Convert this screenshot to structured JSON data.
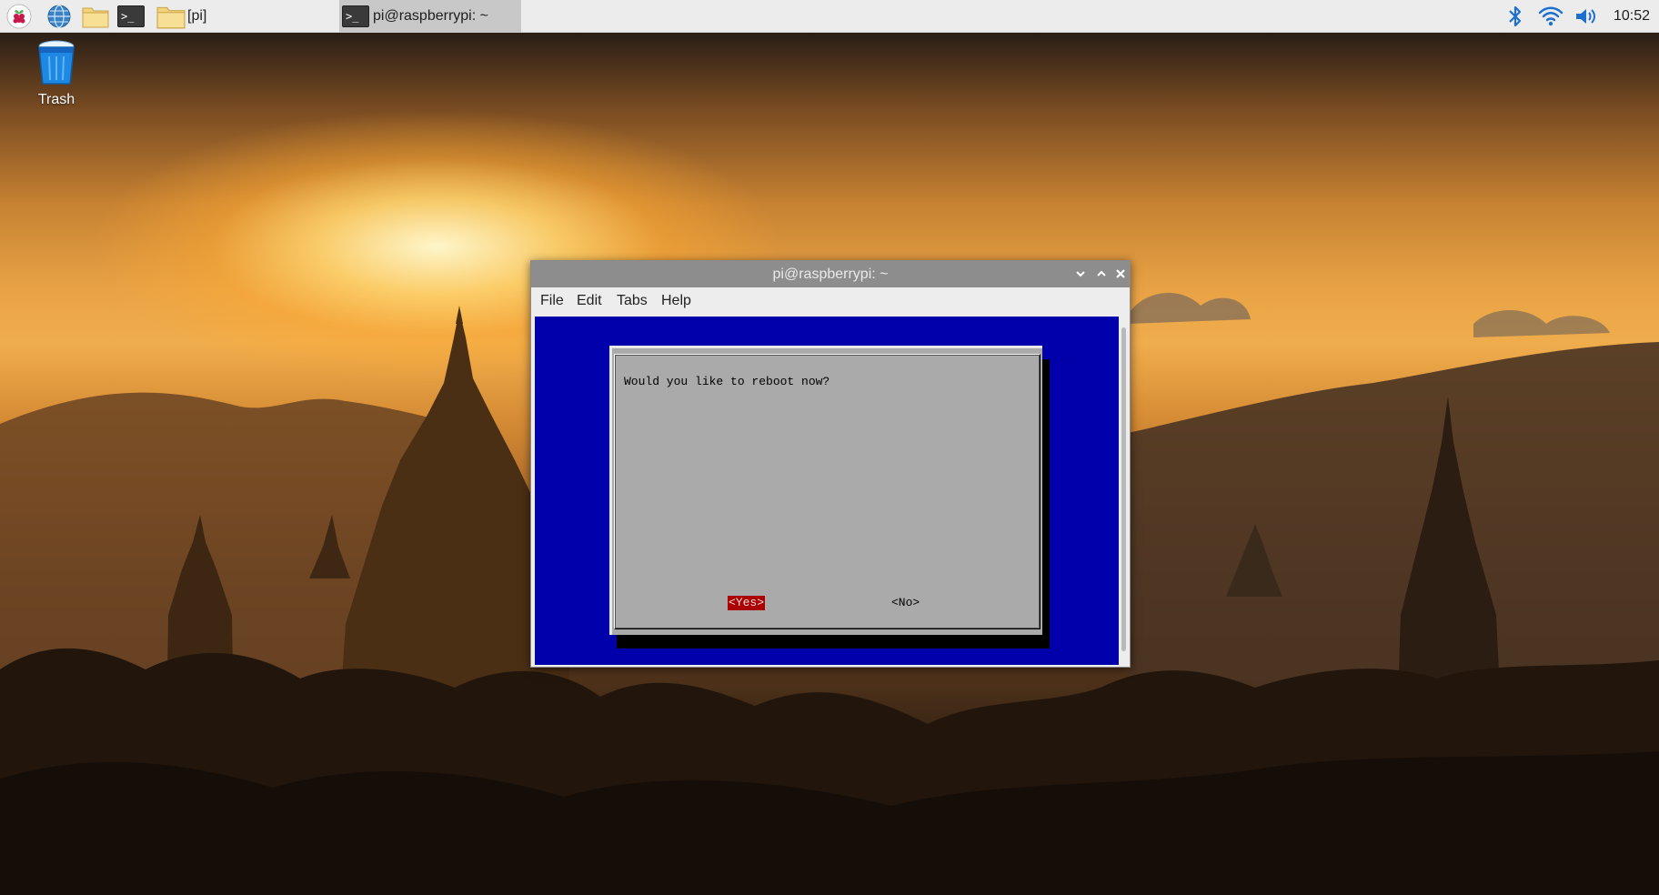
{
  "taskbar": {
    "launchers": [
      {
        "name": "raspberry-menu",
        "icon": "raspberry-icon"
      },
      {
        "name": "web-browser",
        "icon": "globe-icon"
      },
      {
        "name": "file-manager",
        "icon": "folder-icon"
      },
      {
        "name": "terminal",
        "icon": "terminal-icon"
      }
    ],
    "tasks": [
      {
        "label": "[pi]",
        "icon": "folder-icon",
        "active": false
      },
      {
        "label": "pi@raspberrypi: ~",
        "icon": "terminal-icon",
        "active": true
      }
    ],
    "tray": [
      "bluetooth-icon",
      "wifi-icon",
      "volume-icon"
    ],
    "clock": "10:52"
  },
  "desktop": {
    "icons": [
      {
        "label": "Trash",
        "icon": "trash-icon"
      }
    ]
  },
  "window": {
    "title": "pi@raspberrypi: ~",
    "controls": [
      "minimize",
      "maximize",
      "close"
    ],
    "menu": [
      "File",
      "Edit",
      "Tabs",
      "Help"
    ],
    "terminal_bg": "#0000aa",
    "dialog": {
      "message": "Would you like to reboot now?",
      "buttons": {
        "yes": "<Yes>",
        "no": "<No>"
      },
      "selected": "yes"
    }
  },
  "colors": {
    "taskbar": "#ececec",
    "titlebar": "#8d8d8d",
    "dialog_bg": "#aaaaaa",
    "selected_button": "#aa0000"
  }
}
